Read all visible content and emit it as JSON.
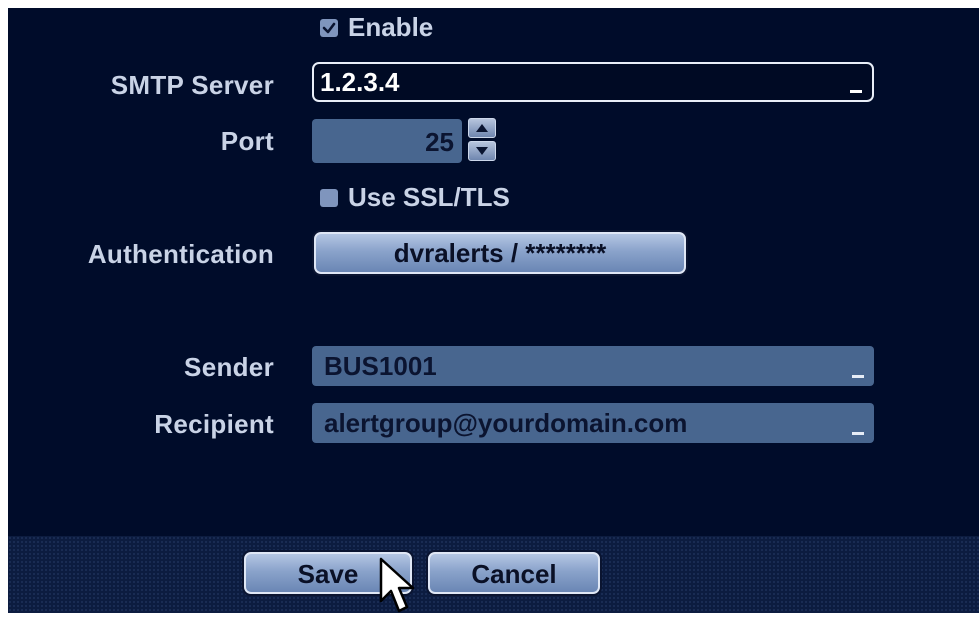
{
  "enable": {
    "label": "Enable",
    "checked": true
  },
  "smtp_server": {
    "label": "SMTP Server",
    "value": "1.2.3.4"
  },
  "port": {
    "label": "Port",
    "value": "25"
  },
  "ssl": {
    "label": "Use SSL/TLS",
    "checked": false
  },
  "authentication": {
    "label": "Authentication",
    "button_label": "dvralerts / ********"
  },
  "sender": {
    "label": "Sender",
    "value": "BUS1001"
  },
  "recipient": {
    "label": "Recipient",
    "value": "alertgroup@yourdomain.com"
  },
  "footer": {
    "save_label": "Save",
    "cancel_label": "Cancel"
  },
  "colors": {
    "panel_bg": "#000c2a",
    "field_bg": "#48668f",
    "label_text": "#c9d3e6",
    "button_face": "#8aa3cb"
  }
}
